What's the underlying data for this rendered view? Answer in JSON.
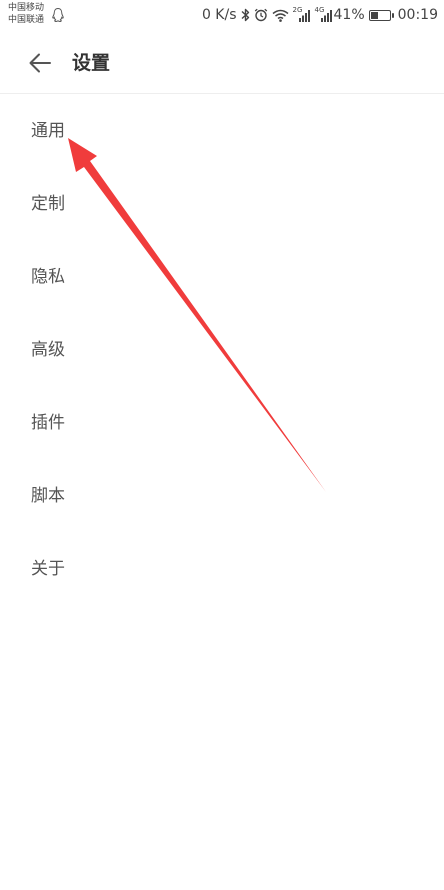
{
  "status_bar": {
    "carrier_1": "中国移动",
    "carrier_2": "中国联通",
    "net_speed": "0 K/s",
    "sim1_network": "2G",
    "sim2_network": "4G",
    "battery_percent": "41%",
    "battery_level": 0.41,
    "time": "00:19",
    "icons": [
      "qq-icon",
      "bluetooth-icon",
      "alarm-icon",
      "wifi-icon",
      "signal-icon",
      "battery-icon"
    ]
  },
  "header": {
    "title": "设置",
    "back_icon": "arrow-left-icon"
  },
  "menu": {
    "items": [
      {
        "label": "通用"
      },
      {
        "label": "定制"
      },
      {
        "label": "隐私"
      },
      {
        "label": "高级"
      },
      {
        "label": "插件"
      },
      {
        "label": "脚本"
      },
      {
        "label": "关于"
      }
    ]
  },
  "annotation": {
    "color": "#f03c3c",
    "icon": "red-arrow-pointing-to-general"
  }
}
